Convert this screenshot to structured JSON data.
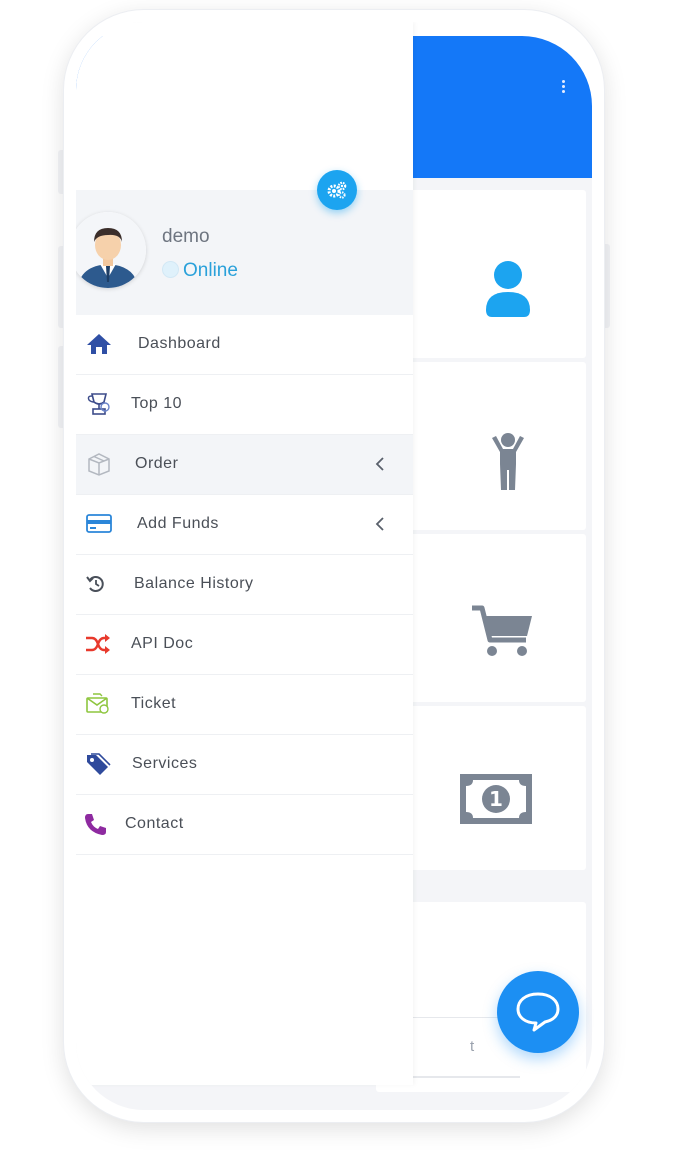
{
  "user": {
    "name": "demo",
    "status": "Online"
  },
  "menu": [
    {
      "label": "Dashboard",
      "icon": "home-icon"
    },
    {
      "label": "Top 10",
      "icon": "trophy-icon"
    },
    {
      "label": "Order",
      "icon": "box-icon"
    },
    {
      "label": "Add Funds",
      "icon": "credit-card-icon"
    },
    {
      "label": "Balance History",
      "icon": "history-icon"
    },
    {
      "label": "API Doc",
      "icon": "shuffle-icon"
    },
    {
      "label": "Ticket",
      "icon": "ticket-icon"
    },
    {
      "label": "Services",
      "icon": "tags-icon"
    },
    {
      "label": "Contact",
      "icon": "phone-icon"
    }
  ],
  "background_panel": {
    "label_fragment": "t"
  },
  "colors": {
    "header": "#1478f8",
    "accent": "#1ca4f0",
    "chat": "#1c8ff3",
    "status": "#2aa1da"
  }
}
